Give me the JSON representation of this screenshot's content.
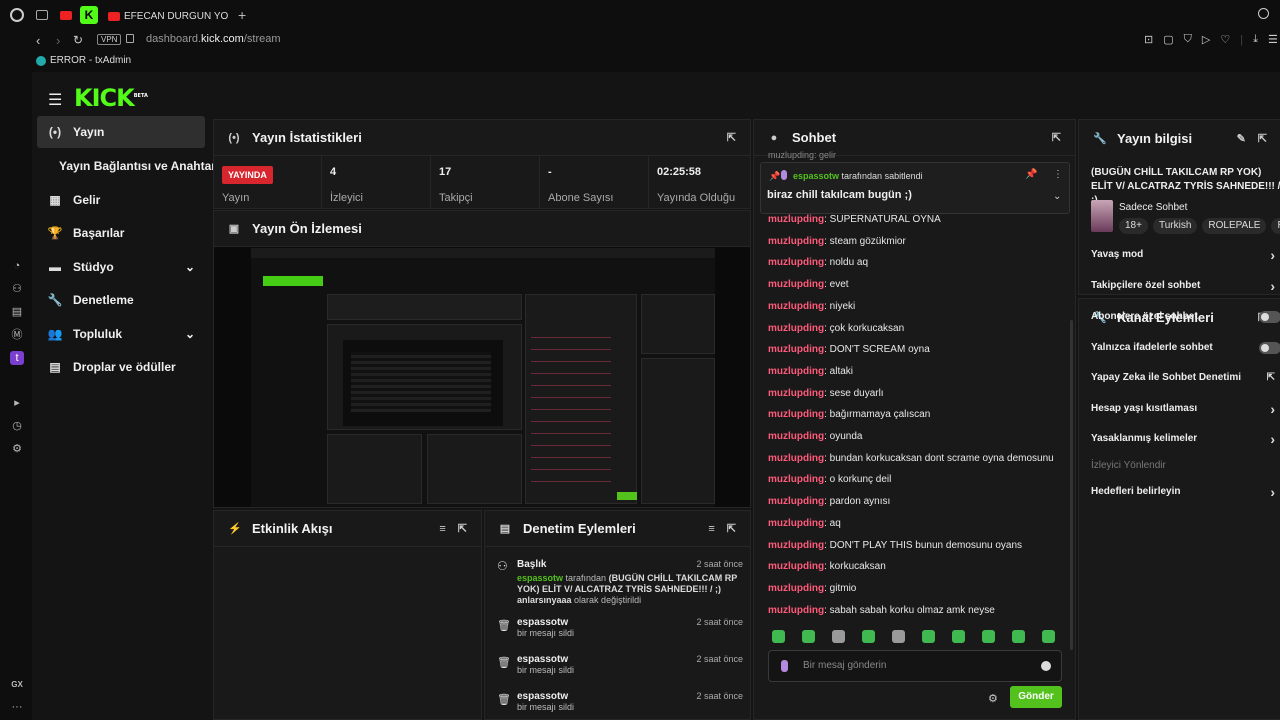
{
  "browser": {
    "tab_title": "EFECAN DURGUN YOUTUB",
    "vpn": "VPN",
    "url_prefix": "dashboard.",
    "url_domain": "kick.com",
    "url_path": "/stream",
    "bookmark": "ERROR - txAdmin",
    "gx_label": "GX"
  },
  "kick": {
    "logo": "KICK",
    "logo_badge": "BETA",
    "nav": [
      {
        "label": "Yayın",
        "icon": "stream-icon"
      },
      {
        "label": "Yayın Bağlantısı ve Anahtarı",
        "icon": ""
      },
      {
        "label": "Gelir",
        "icon": "revenue-icon"
      },
      {
        "label": "Başarılar",
        "icon": "trophy-icon"
      },
      {
        "label": "Stüdyo",
        "icon": "studio-icon"
      },
      {
        "label": "Denetleme",
        "icon": "wrench-icon"
      },
      {
        "label": "Topluluk",
        "icon": "community-icon"
      },
      {
        "label": "Droplar ve ödüller",
        "icon": "drops-icon"
      }
    ]
  },
  "stats": {
    "title": "Yayın İstatistikleri",
    "live_badge": "YAYINDA",
    "live_label": "Yayın",
    "viewers_value": "4",
    "viewers_label": "İzleyici",
    "followers_value": "17",
    "followers_label": "Takipçi",
    "subs_value": "-",
    "subs_label": "Abone Sayısı",
    "uptime_value": "02:25:58",
    "uptime_label": "Yayında Olduğu"
  },
  "preview": {
    "title": "Yayın Ön İzlemesi"
  },
  "activity": {
    "title": "Etkinlik Akışı"
  },
  "modactions": {
    "title": "Denetim Eylemleri",
    "items": [
      {
        "title": "Başlık",
        "time": "2 saat önce",
        "user": "espassotw",
        "mid": " tarafından ",
        "text": "(BUGÜN CHİLL TAKILCAM RP YOK) ELİT V/ ALCATRAZ TYRİS SAHNEDE!!! / ;) anlarsınyaaa",
        "suffix": " olarak değiştirildi"
      },
      {
        "title": "espassotw",
        "time": "2 saat önce",
        "sub": "bir mesajı sildi"
      },
      {
        "title": "espassotw",
        "time": "2 saat önce",
        "sub": "bir mesajı sildi"
      },
      {
        "title": "espassotw",
        "time": "2 saat önce",
        "sub": "bir mesajı sildi"
      }
    ]
  },
  "chat": {
    "title": "Sohbet",
    "pinned_user": "espassotw",
    "pinned_by": " tarafından sabitlendi",
    "pinned_msg": "biraz chill takılcam bugün ;)",
    "top_partial": "muzlupding: gelir",
    "messages": [
      {
        "user": "muzlupding",
        "text": "SUPERNATURAL OYNA"
      },
      {
        "user": "muzlupding",
        "text": "steam gözükmior"
      },
      {
        "user": "muzlupding",
        "text": "noldu aq"
      },
      {
        "user": "muzlupding",
        "text": "evet"
      },
      {
        "user": "muzlupding",
        "text": "niyeki"
      },
      {
        "user": "muzlupding",
        "text": "çok korkucaksan"
      },
      {
        "user": "muzlupding",
        "text": "DON'T SCREAM oyna"
      },
      {
        "user": "muzlupding",
        "text": "altaki"
      },
      {
        "user": "muzlupding",
        "text": "sese duyarlı"
      },
      {
        "user": "muzlupding",
        "text": "bağırmamaya çalıscan"
      },
      {
        "user": "muzlupding",
        "text": "oyunda"
      },
      {
        "user": "muzlupding",
        "text": "bundan korkucaksan dont scrame oyna demosunu"
      },
      {
        "user": "muzlupding",
        "text": "o korkunç deil"
      },
      {
        "user": "muzlupding",
        "text": "pardon aynısı"
      },
      {
        "user": "muzlupding",
        "text": "aq"
      },
      {
        "user": "muzlupding",
        "text": "DON'T PLAY THIS bunun demosunu oyans"
      },
      {
        "user": "muzlupding",
        "text": "korkucaksan"
      },
      {
        "user": "muzlupding",
        "text": "gitmio"
      },
      {
        "user": "muzlupding",
        "text": "sabah sabah korku olmaz amk neyse"
      }
    ],
    "input_placeholder": "Bir mesaj gönderin",
    "send": "Gönder"
  },
  "info": {
    "title": "Yayın bilgisi",
    "stream_title": "(BUGÜN CHİLL TAKILCAM RP YOK) ELİT V/ ALCATRAZ TYRİS SAHNEDE!!! / ;)...",
    "category": "Sadece Sohbet",
    "tags": [
      "18+",
      "Turkish",
      "ROLEPALE",
      "R"
    ]
  },
  "channel": {
    "title": "Kanal Eylemleri",
    "rows": [
      {
        "label": "Yavaş mod",
        "ctrl": "chevron"
      },
      {
        "label": "Takipçilere özel sohbet",
        "ctrl": "chevron"
      },
      {
        "label": "Abonelere özel sohbet",
        "ctrl": "toggle"
      },
      {
        "label": "Yalnızca ifadelerle sohbet",
        "ctrl": "toggle"
      },
      {
        "label": "Yapay Zeka ile Sohbet Denetimi",
        "ctrl": "external"
      },
      {
        "label": "Hesap yaşı kısıtlaması",
        "ctrl": "chevron"
      },
      {
        "label": "Yasaklanmış kelimeler",
        "ctrl": "chevron"
      },
      {
        "label": "İzleyici Yönlendir",
        "ctrl": "none"
      },
      {
        "label": "Hedefleri belirleyin",
        "ctrl": "chevron"
      }
    ]
  },
  "colors": {
    "kick_green": "#53fc18",
    "live_red": "#d8262f",
    "username_pink": "#ff5a7a",
    "send_green": "#53c21d"
  }
}
